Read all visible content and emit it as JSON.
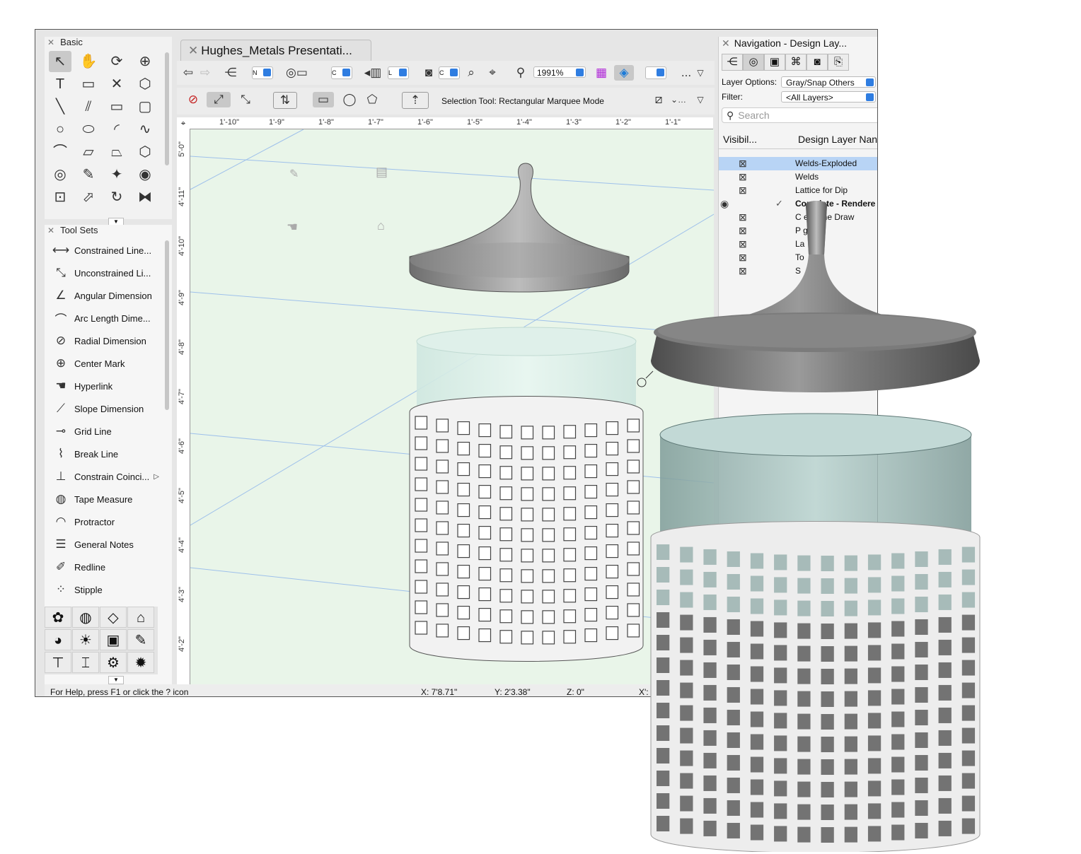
{
  "basic_palette": {
    "title": "Basic",
    "tools": [
      {
        "icon": "pointer-icon",
        "glyph": "↖"
      },
      {
        "icon": "pan-hand-icon",
        "glyph": "✋"
      },
      {
        "icon": "flyover-icon",
        "glyph": "⟳"
      },
      {
        "icon": "zoom-icon",
        "glyph": "⊕"
      },
      {
        "icon": "text-icon",
        "glyph": "T"
      },
      {
        "icon": "callout-icon",
        "glyph": "▭"
      },
      {
        "icon": "x-mark-icon",
        "glyph": "✕"
      },
      {
        "icon": "extrude-icon",
        "glyph": "⬡"
      },
      {
        "icon": "line-icon",
        "glyph": "╲"
      },
      {
        "icon": "double-line-icon",
        "glyph": "⫽"
      },
      {
        "icon": "rectangle-icon",
        "glyph": "▭"
      },
      {
        "icon": "rounded-rectangle-icon",
        "glyph": "▢"
      },
      {
        "icon": "circle-icon",
        "glyph": "○"
      },
      {
        "icon": "oval-icon",
        "glyph": "⬭"
      },
      {
        "icon": "arc-icon",
        "glyph": "◜"
      },
      {
        "icon": "freehand-icon",
        "glyph": "∿"
      },
      {
        "icon": "polyline-icon",
        "glyph": "⌒"
      },
      {
        "icon": "polygon-icon",
        "glyph": "▱"
      },
      {
        "icon": "double-polygon-icon",
        "glyph": "⏢"
      },
      {
        "icon": "regular-polygon-icon",
        "glyph": "⬡"
      },
      {
        "icon": "spiral-icon",
        "glyph": "◎"
      },
      {
        "icon": "eyedropper-icon",
        "glyph": "✎"
      },
      {
        "icon": "magic-wand-icon",
        "glyph": "✦"
      },
      {
        "icon": "visibility-icon",
        "glyph": "◉"
      },
      {
        "icon": "resize-icon",
        "glyph": "⊡"
      },
      {
        "icon": "reshape-icon",
        "glyph": "⬀"
      },
      {
        "icon": "rotate-icon",
        "glyph": "↻"
      },
      {
        "icon": "mirror-icon",
        "glyph": "⧓"
      }
    ]
  },
  "tool_sets": {
    "title": "Tool Sets",
    "items": [
      {
        "label": "Constrained Line...",
        "icon": "constrained-line-icon",
        "glyph": "⟷"
      },
      {
        "label": "Unconstrained Li...",
        "icon": "unconstrained-line-icon",
        "glyph": "⤡"
      },
      {
        "label": "Angular Dimension",
        "icon": "angular-dimension-icon",
        "glyph": "∠"
      },
      {
        "label": "Arc Length Dime...",
        "icon": "arc-length-icon",
        "glyph": "⌒"
      },
      {
        "label": "Radial Dimension",
        "icon": "radial-dimension-icon",
        "glyph": "⊘"
      },
      {
        "label": "Center Mark",
        "icon": "center-mark-icon",
        "glyph": "⊕"
      },
      {
        "label": "Hyperlink",
        "icon": "hyperlink-hand-icon",
        "glyph": "☚"
      },
      {
        "label": "Slope Dimension",
        "icon": "slope-dimension-icon",
        "glyph": "⟋"
      },
      {
        "label": "Grid Line",
        "icon": "grid-line-icon",
        "glyph": "⊸"
      },
      {
        "label": "Break Line",
        "icon": "break-line-icon",
        "glyph": "⌇"
      },
      {
        "label": "Constrain Coinci...",
        "icon": "constrain-coincident-icon",
        "glyph": "⊥",
        "submenu": "▷"
      },
      {
        "label": "Tape Measure",
        "icon": "tape-measure-icon",
        "glyph": "◍"
      },
      {
        "label": "Protractor",
        "icon": "protractor-icon",
        "glyph": "◠"
      },
      {
        "label": "General Notes",
        "icon": "general-notes-icon",
        "glyph": "☰"
      },
      {
        "label": "Redline",
        "icon": "redline-icon",
        "glyph": "✐"
      },
      {
        "label": "Stipple",
        "icon": "stipple-icon",
        "glyph": "⁘"
      }
    ],
    "sets": [
      {
        "icon": "site-planning-icon",
        "glyph": "✿"
      },
      {
        "icon": "globe-icon",
        "glyph": "◍"
      },
      {
        "icon": "landscape-icon",
        "glyph": "◇"
      },
      {
        "icon": "building-icon",
        "glyph": "⌂"
      },
      {
        "icon": "visualization-icon",
        "glyph": "◕"
      },
      {
        "icon": "lighting-icon",
        "glyph": "☀"
      },
      {
        "icon": "furniture-icon",
        "glyph": "▣"
      },
      {
        "icon": "dims-notes-icon",
        "glyph": "✎"
      },
      {
        "icon": "pipe-icon",
        "glyph": "⊤"
      },
      {
        "icon": "steel-beam-icon",
        "glyph": "⌶"
      },
      {
        "icon": "machine-components-icon",
        "glyph": "⚙"
      },
      {
        "icon": "gear-icon",
        "glyph": "✹"
      }
    ]
  },
  "document": {
    "tab_title": "Hughes_Metals Presentati...",
    "zoom": "1991%",
    "mode_message": "Selection Tool: Rectangular Marquee Mode",
    "more": "...",
    "pop1": "N",
    "pop2": "C",
    "pop3": "L",
    "pop4": "C"
  },
  "ruler": {
    "h_labels": [
      "1'-10\"",
      "1'-9\"",
      "1'-8\"",
      "1'-7\"",
      "1'-6\"",
      "1'-5\"",
      "1'-4\"",
      "1'-3\"",
      "1'-2\"",
      "1'-1\""
    ],
    "v_labels": [
      "5'-0\"",
      "4'-11\"",
      "4'-10\"",
      "4'-9\"",
      "4'-8\"",
      "4'-7\"",
      "4'-6\"",
      "4'-5\"",
      "4'-4\"",
      "4'-3\"",
      "4'-2\""
    ]
  },
  "status": {
    "help": "For Help, press F1 or click the ? icon",
    "x": "X:  7'8.71\"",
    "y": "Y:  2'3.38\"",
    "z": "Z:  0\"",
    "x2": "X':"
  },
  "navigation": {
    "title": "Navigation - Design Lay...",
    "layer_options_label": "Layer Options:",
    "layer_options_value": "Gray/Snap Others",
    "filter_label": "Filter:",
    "filter_value": "<All Layers>",
    "search_placeholder": "Search",
    "col_visibility": "Visibil...",
    "col_name": "Design Layer Nan",
    "layers": [
      {
        "name": "Welds-Exploded",
        "visible": "hidden",
        "selected": true,
        "active": false
      },
      {
        "name": "Welds",
        "visible": "hidden",
        "selected": false,
        "active": false
      },
      {
        "name": "Lattice for Dip",
        "visible": "hidden",
        "selected": false,
        "active": false
      },
      {
        "name": "Complete - Rendere",
        "visible": "visible",
        "selected": false,
        "active": true
      },
      {
        "name": "C    e - Line Draw",
        "visible": "hidden",
        "selected": false,
        "active": false
      },
      {
        "name": "P     g",
        "visible": "hidden",
        "selected": false,
        "active": false
      },
      {
        "name": "La",
        "visible": "hidden",
        "selected": false,
        "active": false
      },
      {
        "name": "To",
        "visible": "hidden",
        "selected": false,
        "active": false
      },
      {
        "name": "S",
        "visible": "hidden",
        "selected": false,
        "active": false
      }
    ]
  },
  "colors": {
    "accent": "#2f7de1",
    "drawing_bg": "#e9f5e9",
    "selection": "#b8d4f5"
  }
}
